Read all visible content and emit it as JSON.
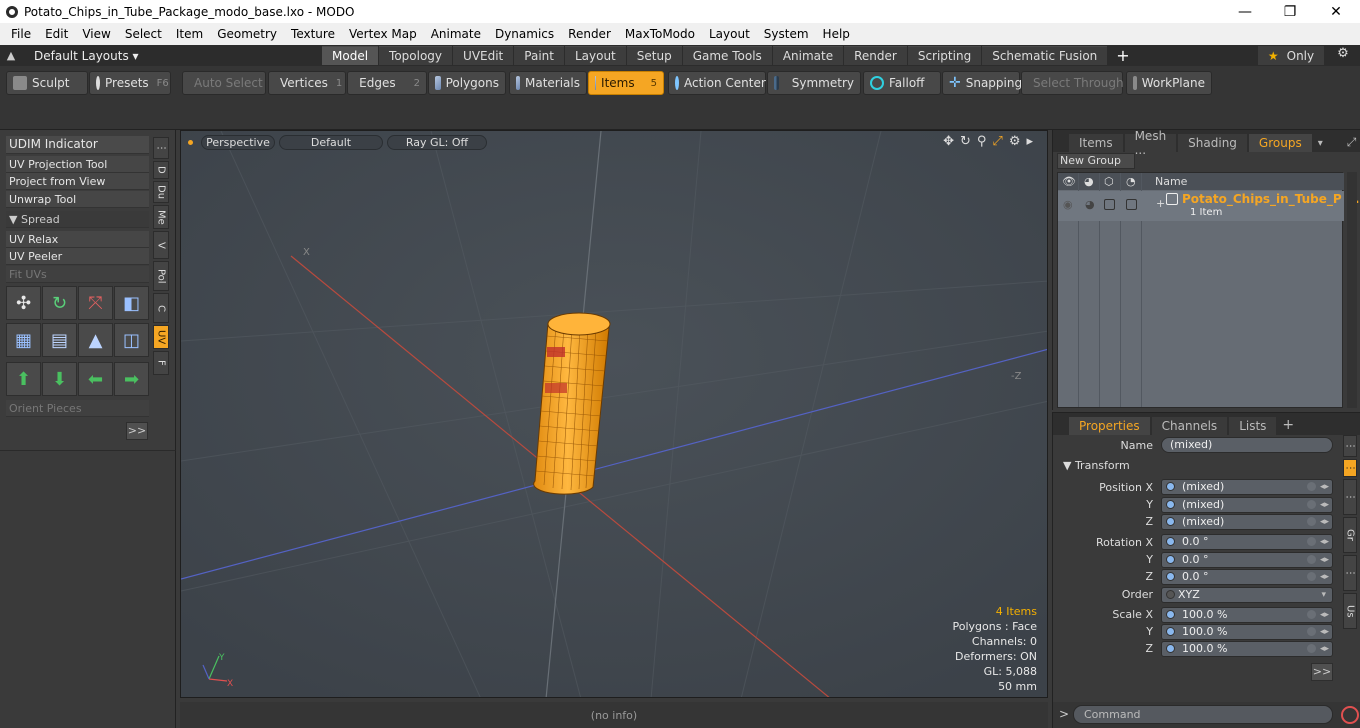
{
  "window": {
    "title": "Potato_Chips_in_Tube_Package_modo_base.lxo - MODO",
    "minimize": "—",
    "maximize": "❐",
    "close": "✕"
  },
  "menu": [
    "File",
    "Edit",
    "View",
    "Select",
    "Item",
    "Geometry",
    "Texture",
    "Vertex Map",
    "Animate",
    "Dynamics",
    "Render",
    "MaxToModo",
    "Layout",
    "System",
    "Help"
  ],
  "layouts": {
    "dropdown_label": "Default Layouts ▾",
    "tabs": [
      "Model",
      "Topology",
      "UVEdit",
      "Paint",
      "Layout",
      "Setup",
      "Game Tools",
      "Animate",
      "Render",
      "Scripting",
      "Schematic Fusion"
    ],
    "active_tab": "Model",
    "add_tab": "+",
    "only_label": "Only"
  },
  "toolbar": {
    "sculpt": "Sculpt",
    "presets": "Presets",
    "presets_key": "F6",
    "auto_select": "Auto Select",
    "vertices": "Vertices",
    "vertices_key": "1",
    "edges": "Edges",
    "edges_key": "2",
    "polygons": "Polygons",
    "materials": "Materials",
    "items": "Items",
    "items_key": "5",
    "action_center": "Action Center",
    "symmetry": "Symmetry",
    "falloff": "Falloff",
    "snapping": "Snapping",
    "select_through": "Select Through",
    "workplane": "WorkPlane"
  },
  "left_panel": {
    "items": [
      "UDIM Indicator",
      "UV Projection Tool",
      "Project from View",
      "Unwrap Tool"
    ],
    "spread_header": "▼ Spread",
    "items2": [
      "UV Relax",
      "UV Peeler"
    ],
    "fit_uvs": "Fit UVs",
    "orient_pieces": "Orient Pieces",
    "expand": ">>",
    "vtabs": [
      "D",
      "Du",
      "Me",
      "V",
      "Pol",
      "C",
      "UV",
      "F"
    ]
  },
  "viewport": {
    "view_mode": "Perspective",
    "shading": "Default",
    "raygl": "Ray GL: Off",
    "axis_x_label": "X",
    "axis_z_label": "-Z",
    "gizmo_y": "Y",
    "gizmo_x": "X",
    "info": {
      "items": "4 Items",
      "polygons": "Polygons : Face",
      "channels": "Channels: 0",
      "deformers": "Deformers: ON",
      "gl": "GL: 5,088",
      "scale": "50 mm"
    }
  },
  "status": "(no info)",
  "groups_panel": {
    "tabs": [
      "Items",
      "Mesh ...",
      "Shading",
      "Groups"
    ],
    "active_tab": "Groups",
    "new_group": "New Group",
    "col_name": "Name",
    "row_name": "Potato_Chips_in_Tube_P ...",
    "row_sub": "1 Item"
  },
  "properties": {
    "tabs": [
      "Properties",
      "Channels",
      "Lists"
    ],
    "active_tab": "Properties",
    "add_tab": "+",
    "name_label": "Name",
    "name_value": "(mixed)",
    "transform_header": "▼ Transform",
    "position_x_label": "Position X",
    "position": [
      "(mixed)",
      "(mixed)",
      "(mixed)"
    ],
    "rotation_x_label": "Rotation X",
    "rotation": [
      "0.0 °",
      "0.0 °",
      "0.0 °"
    ],
    "order_label": "Order",
    "order_value": "XYZ",
    "scale_x_label": "Scale X",
    "scale": [
      "100.0 %",
      "100.0 %",
      "100.0 %"
    ],
    "y_label": "Y",
    "z_label": "Z",
    "expand": ">>",
    "vtabs": [
      "Gr",
      "Us"
    ]
  },
  "command": {
    "prompt": ">",
    "placeholder": "Command"
  },
  "colors": {
    "accent": "#f5a623",
    "viewport_bg": "#444b52",
    "x_axis": "#c0453a",
    "z_axis": "#5560c8"
  }
}
